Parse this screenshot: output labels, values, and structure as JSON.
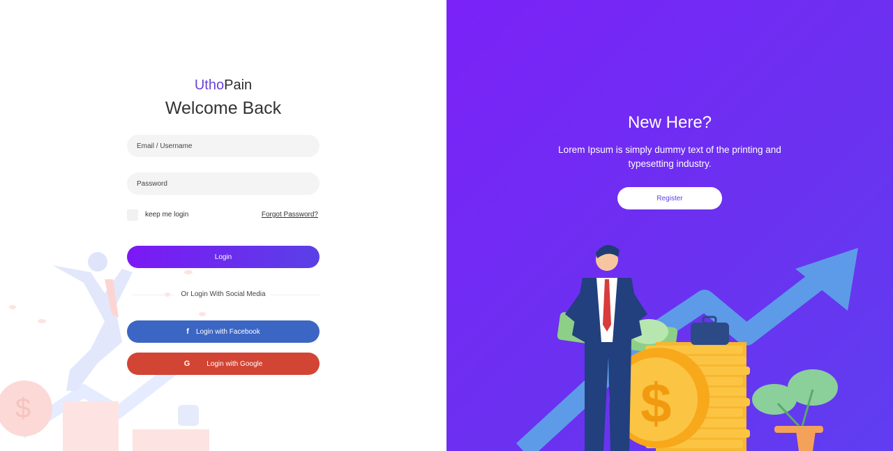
{
  "brand": {
    "part1": "Utho",
    "part2": "Pain"
  },
  "login": {
    "heading": "Welcome Back",
    "email_placeholder": "Email / Username",
    "password_placeholder": "Password",
    "keep_label": "keep me login",
    "forgot_label": "Forgot Password?",
    "login_button": "Login",
    "social_divider": "Or Login With Social Media",
    "facebook_button": "Login with Facebook",
    "google_button": "Login with Google",
    "facebook_icon": "f",
    "google_icon": "G"
  },
  "register_panel": {
    "heading": "New Here?",
    "text": "Lorem Ipsum is simply dummy text of the printing and typesetting industry.",
    "register_button": "Register"
  },
  "colors": {
    "brand_accent": "#6a41d8",
    "panel_gradient_start": "#7b22f8",
    "panel_gradient_end": "#5f3ef0",
    "login_button": "#7c18f5",
    "facebook": "#3b66c4",
    "google": "#d24434"
  }
}
